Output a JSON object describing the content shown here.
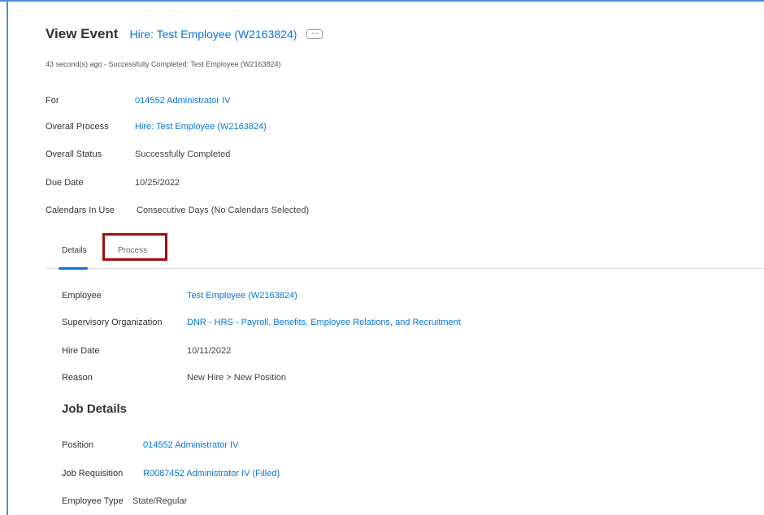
{
  "header": {
    "title": "View Event",
    "event_link": "Hire: Test Employee (W2163824)",
    "related_actions_glyph": "⋯",
    "related_actions_icon": "ellipsis-icon"
  },
  "subtitle": "43 second(s) ago - Successfully Completed: Test Employee (W2163824)",
  "event_fields": [
    {
      "label": "For",
      "value": "014552 Administrator IV"
    },
    {
      "label": "Overall Process",
      "value": "Hire: Test Employee (W2163824)"
    },
    {
      "label": "Overall Status",
      "value": "Successfully Completed"
    },
    {
      "label": "Due Date",
      "value": "10/25/2022"
    },
    {
      "label": "Calendars In Use",
      "value": "Consecutive Days (No Calendars Selected)"
    }
  ],
  "tabs": [
    {
      "label": "Details",
      "selected": true
    },
    {
      "label": "Process",
      "selected": false
    }
  ],
  "details_fields": [
    {
      "label": "Employee",
      "value": "Test Employee (W2163824)"
    },
    {
      "label": "Supervisory Organization",
      "value": "DNR - HRS - Payroll, Benefits, Employee Relations, and Recruitment"
    },
    {
      "label": "Hire Date",
      "value": "10/11/2022"
    },
    {
      "label": "Reason",
      "value": "New Hire > New Position"
    }
  ],
  "job_details": {
    "heading": "Job Details",
    "fields": [
      {
        "label": "Position",
        "value": "014552 Administrator IV"
      },
      {
        "label": "Job Requisition",
        "value": "R0087452 Administrator IV (Filled)"
      },
      {
        "label": "Employee Type",
        "value": "State/Regular"
      }
    ]
  },
  "colors": {
    "link": "#0875e1",
    "highlight_box": "#a10d0d",
    "tab_underline": "#0875e1",
    "frame": "#4a90d9"
  }
}
